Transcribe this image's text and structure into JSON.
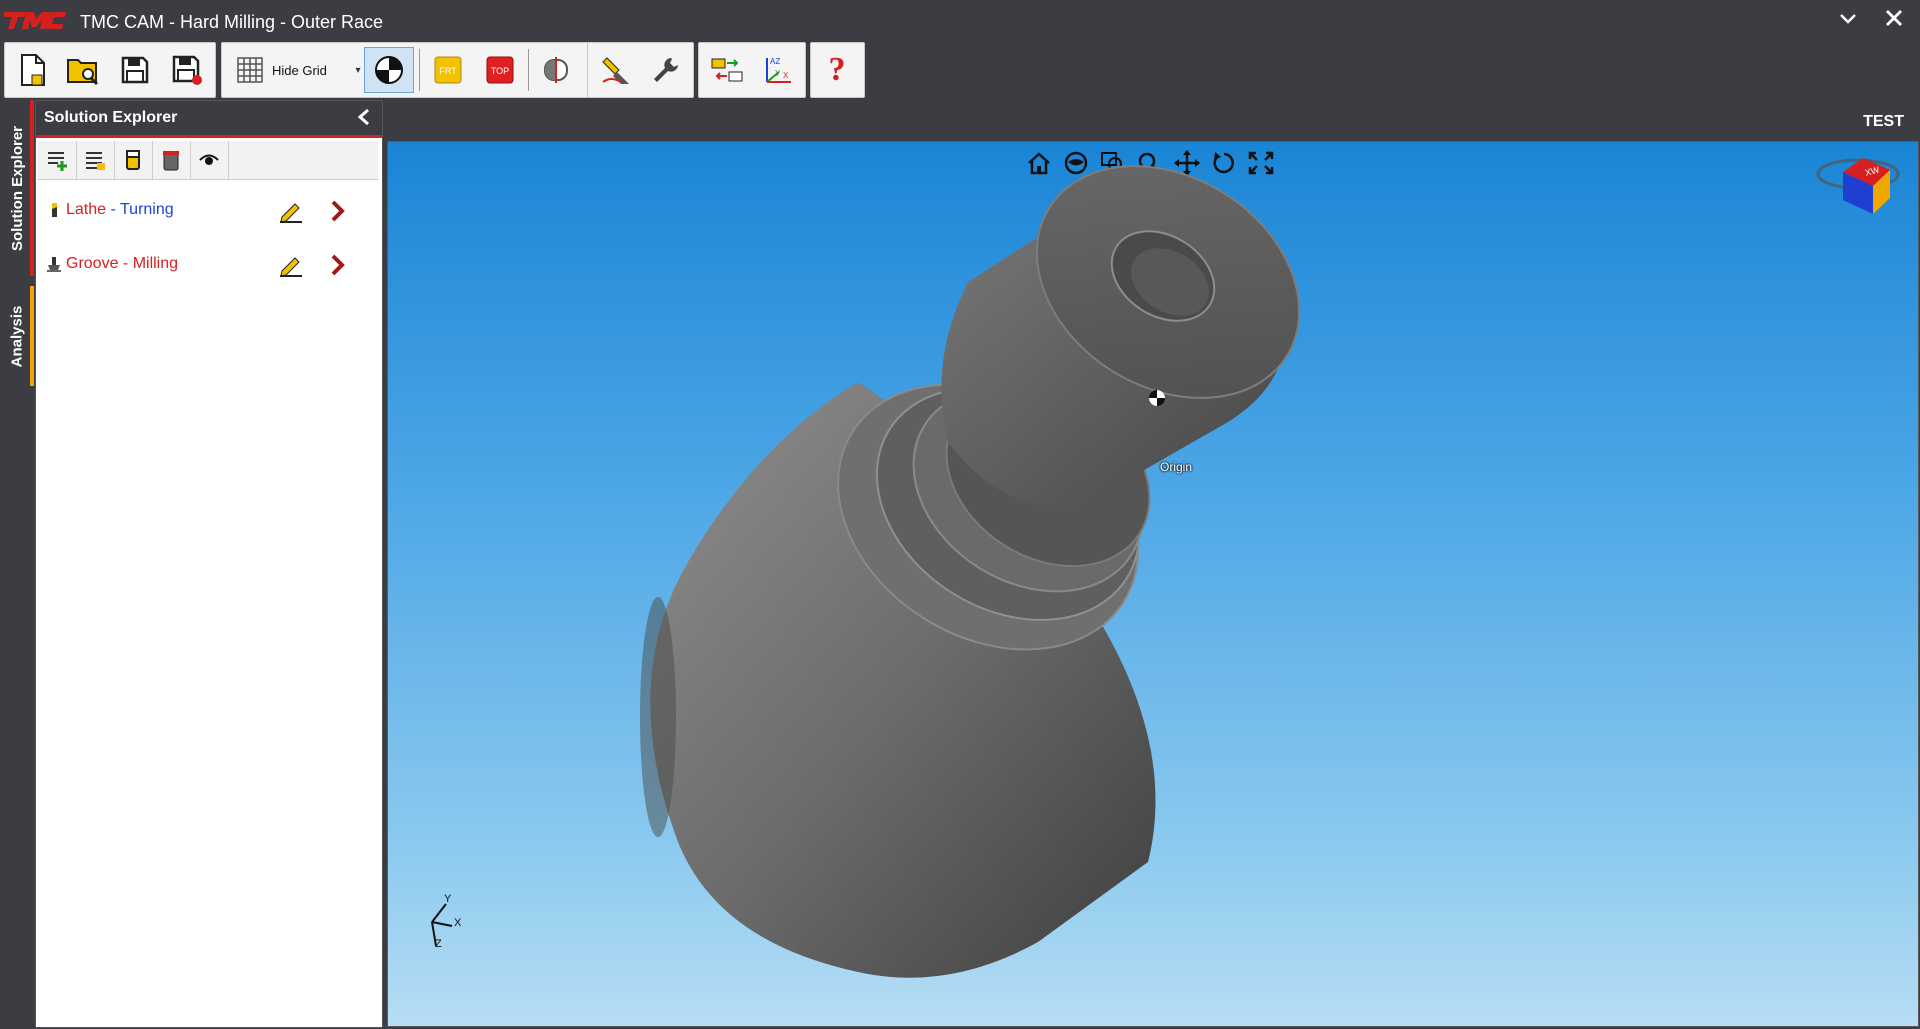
{
  "window": {
    "title": "TMC CAM - Hard Milling - Outer Race",
    "logo_icon": "tmc-logo-icon",
    "minimize_icon": "chevron-down-icon",
    "close_icon": "close-icon"
  },
  "toolbar": {
    "hide_grid_label": "Hide Grid",
    "buttons": [
      "new-file-icon",
      "open-file-icon",
      "save-icon",
      "save-as-icon",
      "grid-icon",
      "origin-icon",
      "front-view-icon",
      "top-view-icon",
      "section-view-icon",
      "tool-path-icon",
      "wrench-icon",
      "compare-icon",
      "axis-icon",
      "help-icon"
    ],
    "front_label": "FRT",
    "top_label": "TOP",
    "help_label": "?"
  },
  "side_tabs": [
    {
      "label": "Solution Explorer",
      "accent": "#d6201f"
    },
    {
      "label": "Analysis",
      "accent": "#f0a800"
    }
  ],
  "explorer": {
    "title": "Solution Explorer",
    "toolbar_icons": [
      "add-operation-icon",
      "add-list-icon",
      "stock-icon",
      "delete-icon",
      "visibility-icon"
    ],
    "items": [
      {
        "label_a": "Lathe",
        "sep": " - ",
        "label_b": "Turning",
        "icon": "lathe-tool-icon"
      },
      {
        "label_a": "Groove",
        "sep": " - ",
        "label_b": "Milling",
        "icon": "mill-tool-icon"
      }
    ]
  },
  "viewport": {
    "name_label": "TEST",
    "origin_label": "Origin",
    "tools": [
      "home-icon",
      "orbit-icon",
      "zoom-window-icon",
      "zoom-icon",
      "pan-icon",
      "rotate-icon",
      "fit-all-icon"
    ],
    "axes": {
      "x": "X",
      "y": "Y",
      "z": "Z"
    },
    "view_cube": {
      "front": "XW",
      "colors": [
        "#d62020",
        "#1e3fd0",
        "#f0a800"
      ]
    }
  },
  "colors": {
    "brand": "#d6201f",
    "chrome": "#3c3d42",
    "link_blue": "#1f3fd6"
  }
}
